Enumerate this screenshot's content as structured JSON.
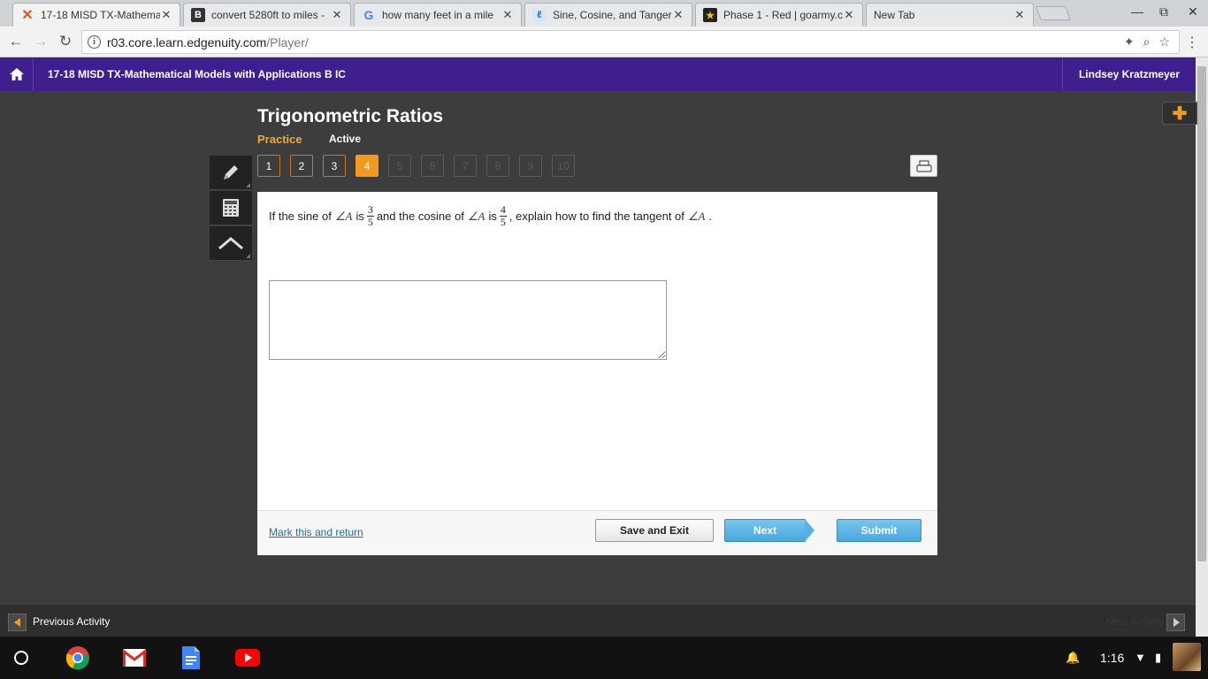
{
  "browser": {
    "tabs": [
      {
        "title": "17-18 MISD TX-Mathema",
        "icon": "edgenuity-icon",
        "active": true
      },
      {
        "title": "convert 5280ft to miles -",
        "icon": "brainly-icon",
        "active": false
      },
      {
        "title": "how many feet in a mile",
        "icon": "google-icon",
        "active": false
      },
      {
        "title": "Sine, Cosine, and Tanger",
        "icon": "desmos-icon",
        "active": false
      },
      {
        "title": "Phase 1 - Red | goarmy.c",
        "icon": "army-icon",
        "active": false
      },
      {
        "title": "New Tab",
        "icon": "",
        "active": false
      }
    ],
    "url_host": "r03.core.learn.edgenuity.com",
    "url_path": "/Player/"
  },
  "header": {
    "course_title": "17-18 MISD TX-Mathematical Models with Applications B IC",
    "user_name": "Lindsey Kratzmeyer"
  },
  "lesson": {
    "title": "Trigonometric Ratios",
    "mode": "Practice",
    "status": "Active",
    "question_numbers": [
      {
        "label": "1",
        "state": "visited"
      },
      {
        "label": "2",
        "state": "visited"
      },
      {
        "label": "3",
        "state": "visited"
      },
      {
        "label": "4",
        "state": "current"
      },
      {
        "label": "5",
        "state": "locked"
      },
      {
        "label": "6",
        "state": "locked"
      },
      {
        "label": "7",
        "state": "locked"
      },
      {
        "label": "8",
        "state": "locked"
      },
      {
        "label": "9",
        "state": "locked"
      },
      {
        "label": "10",
        "state": "locked"
      }
    ]
  },
  "question": {
    "part1": "If the sine of",
    "angle": "∠A",
    "is": "is",
    "sine_num": "3",
    "sine_den": "5",
    "part2": "and the cosine of",
    "cos_num": "4",
    "cos_den": "5",
    "part3": ", explain how to find the tangent of",
    "period": ".",
    "answer_value": ""
  },
  "footer": {
    "mark_link": "Mark this and return",
    "save_label": "Save and Exit",
    "next_label": "Next",
    "submit_label": "Submit"
  },
  "activity_bar": {
    "previous_label": "Previous Activity",
    "next_label": "Next Activity"
  },
  "system": {
    "time": "1:16"
  },
  "colors": {
    "brand_purple": "#3f1e8e",
    "accent_orange": "#f39a1e",
    "button_blue": "#49a7dc"
  }
}
